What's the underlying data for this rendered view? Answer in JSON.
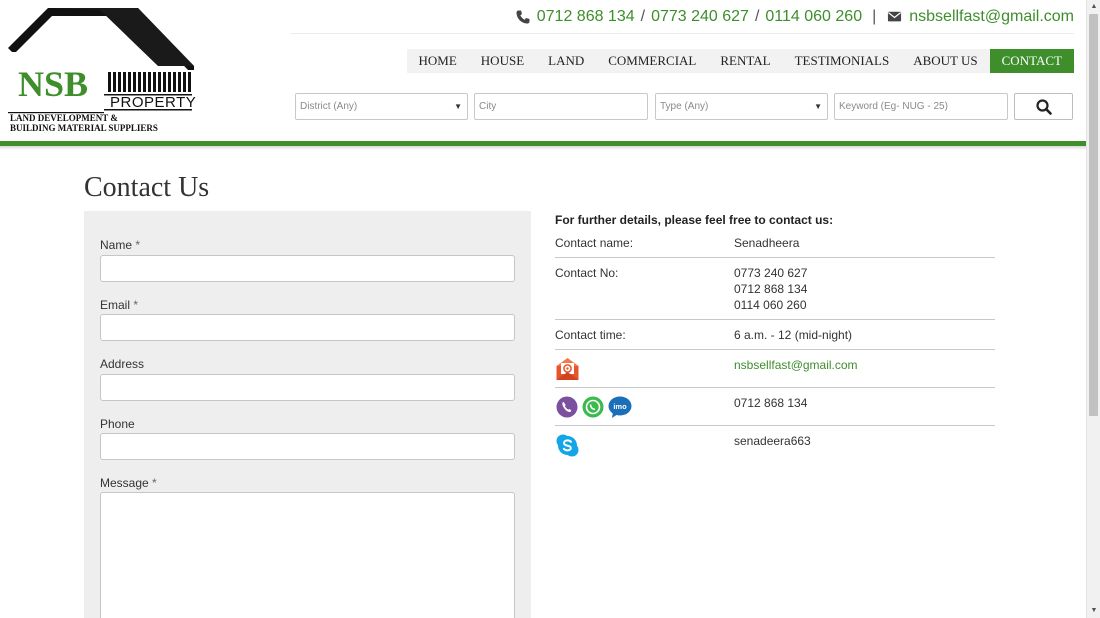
{
  "logo": {
    "brand": "NSB",
    "sub": "PROPERTY",
    "tagline_1": "LAND DEVELOPMENT &",
    "tagline_2": "BUILDING MATERIAL SUPPLIERS"
  },
  "contact_line": {
    "phones": [
      "0712 868 134",
      "0773 240 627",
      "0114 060 260"
    ],
    "separator": "/",
    "divider": "|",
    "email": "nsbsellfast@gmail.com"
  },
  "nav": {
    "items": [
      {
        "label": "HOME",
        "active": false
      },
      {
        "label": "HOUSE",
        "active": false
      },
      {
        "label": "LAND",
        "active": false
      },
      {
        "label": "COMMERCIAL",
        "active": false
      },
      {
        "label": "RENTAL",
        "active": false
      },
      {
        "label": "TESTIMONIALS",
        "active": false
      },
      {
        "label": "ABOUT US",
        "active": false
      },
      {
        "label": "CONTACT",
        "active": true
      }
    ]
  },
  "search": {
    "district": "District (Any)",
    "city_placeholder": "City",
    "type": "Type (Any)",
    "keyword_placeholder": "Keyword (Eg- NUG - 25)"
  },
  "page": {
    "title": "Contact Us"
  },
  "form": {
    "name_label": "Name",
    "email_label": "Email",
    "address_label": "Address",
    "phone_label": "Phone",
    "message_label": "Message",
    "required_mark": "*"
  },
  "details": {
    "heading": "For further details, please feel free to contact us:",
    "name_key": "Contact name:",
    "name_value": "Senadheera",
    "no_key": "Contact No:",
    "numbers": [
      "0773 240 627",
      "0712 868 134",
      "0114 060 260"
    ],
    "time_key": "Contact time:",
    "time_value": "6 a.m. - 12 (mid-night)",
    "email_value": "nsbsellfast@gmail.com",
    "messaging_value": "0712 868 134",
    "imo_text": "imo",
    "skype_value": "senadeera663"
  },
  "colors": {
    "brand_green": "#3e8e2c",
    "panel_bg": "#eeeeee"
  }
}
